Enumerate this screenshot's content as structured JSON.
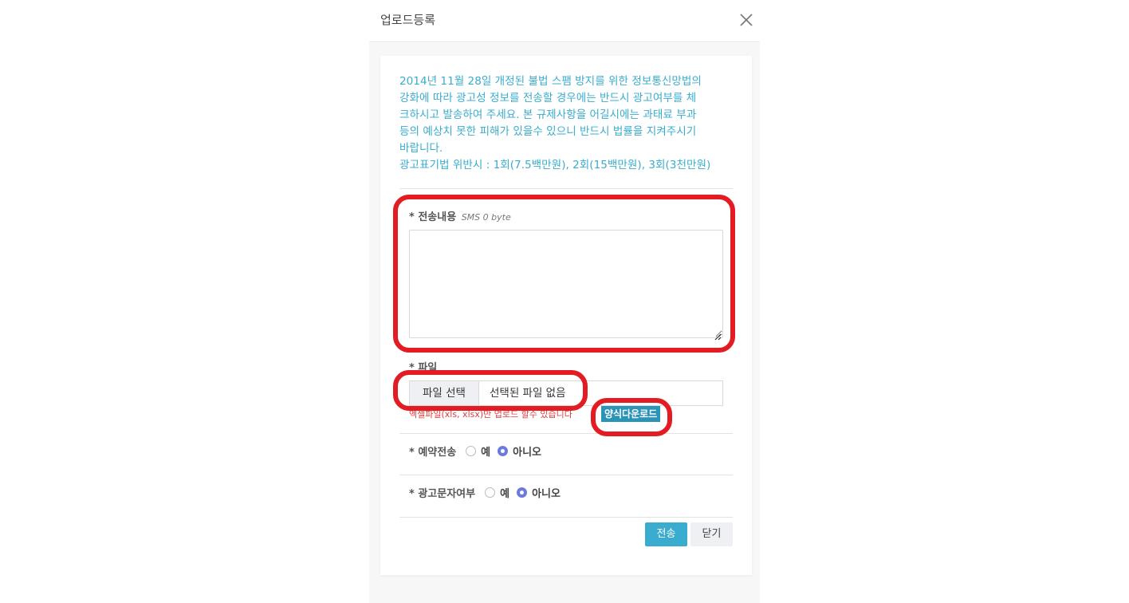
{
  "modal": {
    "title": "업로드등록",
    "notice_lines": [
      "2014년 11월 28일 개정된 불법 스팸 방지를 위한 정보통신망법의",
      "강화에 따라 광고성 정보를 전송할 경우에는 반드시 광고여부를 체",
      "크하시고 발송하여 주세요. 본 규제사항을 어길시에는 과태료 부과",
      "등의 예상치 못한 피해가 있을수 있으니 반드시 법률을 지켜주시기",
      "바랍니다.",
      "광고표기법 위반시 : 1회(7.5백만원), 2회(15백만원), 3회(3천만원)"
    ]
  },
  "content": {
    "label": "* 전송내용",
    "hint": "SMS 0 byte",
    "value": ""
  },
  "file": {
    "label": "* 파일",
    "button_label": "파일 선택",
    "status": "선택된 파일 없음",
    "help": "엑셀파일(xls, xlsx)만 업로드 할수 있습니다",
    "download_label": "양식다운로드"
  },
  "reservation": {
    "label": "* 예약전송",
    "options": [
      "예",
      "아니오"
    ],
    "selected": "아니오"
  },
  "ad": {
    "label": "* 광고문자여부",
    "options": [
      "예",
      "아니오"
    ],
    "selected": "아니오"
  },
  "footer": {
    "send_label": "전송",
    "close_label": "닫기"
  },
  "colors": {
    "accent": "#3aaccf",
    "download_bg": "#2a93b8",
    "radio_checked": "#6c7ae0",
    "annotation": "#e31b23"
  },
  "icons": {
    "close": "close-icon",
    "resize": "resize-grip-icon"
  }
}
